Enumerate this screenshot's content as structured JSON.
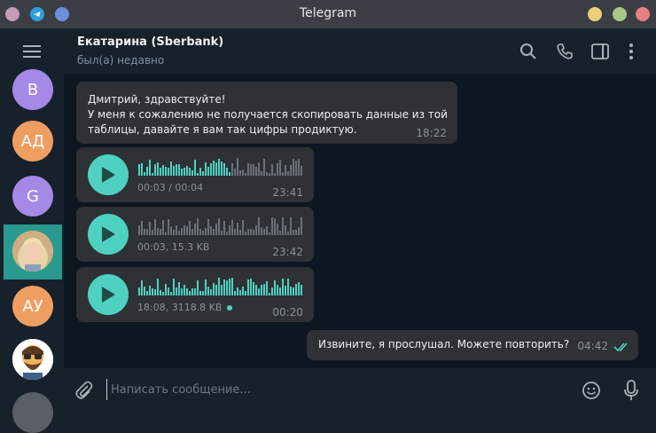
{
  "window": {
    "title": "Telegram",
    "controls": [
      "minimize",
      "maximize",
      "close"
    ],
    "colors": {
      "left_dot": "#c59ab4",
      "telegram": "#2f9fd8",
      "blue_dot": "#6b8fd8",
      "yellow": "#e8d07a",
      "green": "#a7c78a",
      "red": "#e87f82"
    }
  },
  "sidebar": {
    "menu_icon": "hamburger-icon",
    "chats": [
      {
        "initials": "В",
        "color": "#a688e6"
      },
      {
        "initials": "АД",
        "color": "#ef9e62"
      },
      {
        "initials": "G",
        "color": "#a688e6"
      },
      {
        "initials": "",
        "color": "#d4b28a",
        "photo": true,
        "active": true
      },
      {
        "initials": "АУ",
        "color": "#ef9e62"
      },
      {
        "initials": "",
        "color": "#ffffff",
        "photo": true
      },
      {
        "initials": "",
        "color": "#5a5e66",
        "photo": true
      }
    ]
  },
  "header": {
    "name": "Екатарина (Sberbank)",
    "status": "был(а) недавно",
    "icons": [
      "search-icon",
      "phone-icon",
      "sidebar-toggle-icon",
      "more-icon"
    ]
  },
  "messages": [
    {
      "type": "text",
      "text_lines": [
        "Дмитрий, здравствуйте!",
        "У меня к сожалению не получается скопировать данные из той",
        "таблицы, давайте я вам так цифры продиктую."
      ],
      "time": "18:22"
    },
    {
      "type": "voice",
      "info": "00:03 / 00:04",
      "time": "23:41",
      "played": 0.55
    },
    {
      "type": "voice",
      "info": "00:03, 15.3 KB",
      "time": "23:42",
      "played": 0.0
    },
    {
      "type": "voice",
      "info": "18:08, 3118.8 KB",
      "time": "00:20",
      "played": 1.0,
      "unread": true
    },
    {
      "type": "text",
      "outgoing": true,
      "text": "Извините, я прослушал. Можете повторить?",
      "time": "04:42",
      "read": true
    }
  ],
  "composer": {
    "placeholder": "Написать сообщение...",
    "attach_icon": "paperclip-icon",
    "emoji_icon": "emoji-icon",
    "mic_icon": "microphone-icon"
  },
  "theme": {
    "accent": "#4fd1c0",
    "bubble": "#2e3135",
    "bg": "#0e1621",
    "panel": "#17212b",
    "active_chat": "#2b9a8e"
  }
}
